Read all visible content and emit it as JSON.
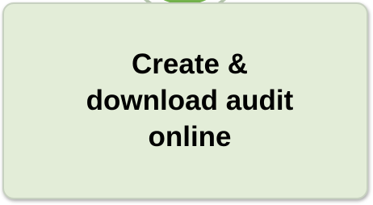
{
  "step": {
    "label_lines": [
      "Create &",
      "download audit",
      "online"
    ]
  },
  "colors": {
    "card_fill": "#e3edd8",
    "card_border": "#c7d1c0",
    "badge_fill": "#76b54e",
    "text": "#000000"
  }
}
